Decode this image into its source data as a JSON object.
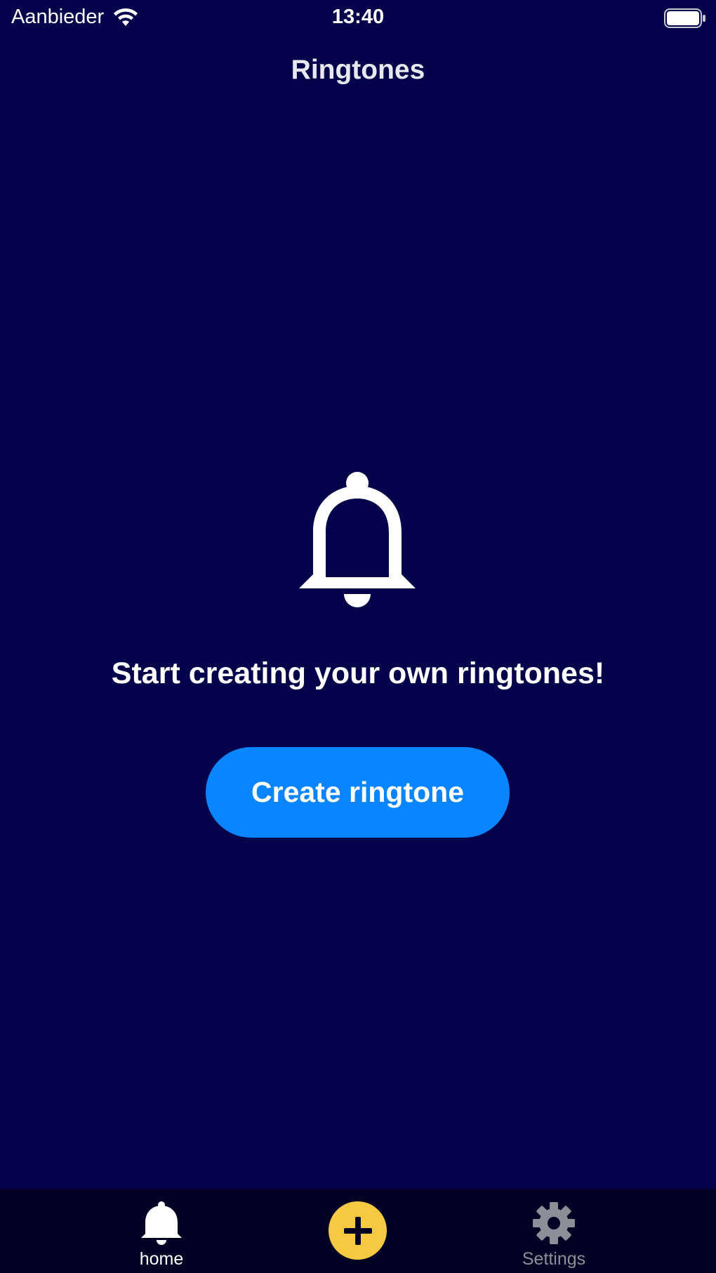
{
  "status_bar": {
    "carrier": "Aanbieder",
    "time": "13:40"
  },
  "nav": {
    "title": "Ringtones"
  },
  "empty_state": {
    "icon": "bell-icon",
    "message": "Start creating your own ringtones!",
    "button_label": "Create ringtone"
  },
  "tab_bar": {
    "items": [
      {
        "label": "home",
        "icon": "bell-icon",
        "active": true
      },
      {
        "label": "",
        "icon": "plus-icon",
        "active": false
      },
      {
        "label": "Settings",
        "icon": "gear-icon",
        "active": false
      }
    ]
  },
  "colors": {
    "background": "#03024a",
    "tab_bar_background": "#020124",
    "primary_button": "#0a84ff",
    "add_button": "#f7c842",
    "inactive_tab": "#8e8e99"
  }
}
